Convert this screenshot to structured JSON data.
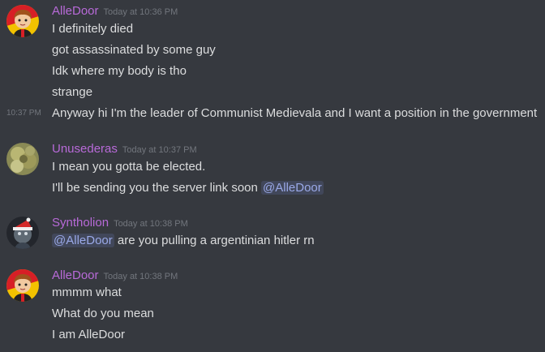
{
  "colors": {
    "background": "#36393f",
    "username": "#b86ad8",
    "timestamp": "#72767d",
    "text": "#dcddde",
    "mention_text": "#9aa9e8"
  },
  "messages": [
    {
      "username": "AlleDoor",
      "timestamp": "Today at 10:36 PM",
      "avatar": "alledoor-avatar",
      "lines": [
        "I definitely died",
        "got assassinated by some guy",
        "Idk where my body is tho",
        "strange"
      ],
      "followup": {
        "side_time": "10:37 PM",
        "text": "Anyway hi I'm the leader of Communist Medievala and I want a position in the government"
      }
    },
    {
      "username": "Unusederas",
      "timestamp": "Today at 10:37 PM",
      "avatar": "unusederas-avatar",
      "lines": [
        "I mean you gotta be elected.",
        "I'll be sending you the server link soon "
      ],
      "mention": "@AlleDoor"
    },
    {
      "username": "Syntholion",
      "timestamp": "Today at 10:38 PM",
      "avatar": "syntholion-avatar",
      "mention": "@AlleDoor",
      "line_after_mention": " are you pulling a argentinian hitler rn"
    },
    {
      "username": "AlleDoor",
      "timestamp": "Today at 10:38 PM",
      "avatar": "alledoor-avatar",
      "lines": [
        "mmmm what",
        "What do you mean",
        "I am AlleDoor"
      ]
    }
  ]
}
